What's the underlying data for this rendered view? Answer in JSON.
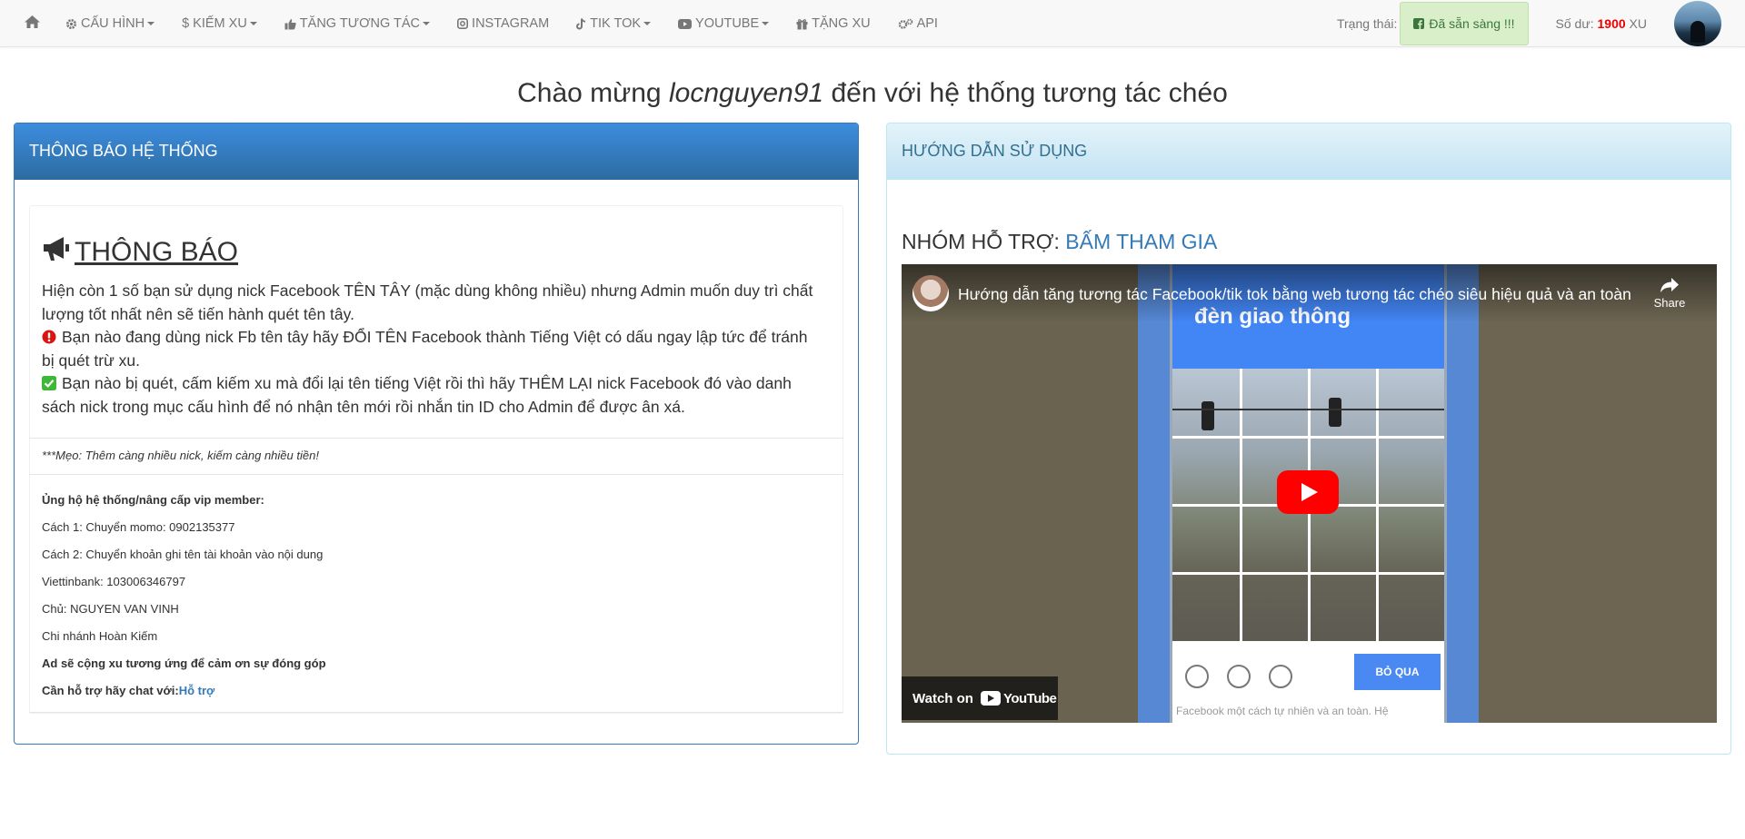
{
  "nav": {
    "items": [
      {
        "label": "CẤU HÌNH",
        "icon": "cog-icon"
      },
      {
        "label": "KIẾM XU",
        "icon": "dollar-icon"
      },
      {
        "label": "TĂNG TƯƠNG TÁC",
        "icon": "thumbs-up-icon"
      },
      {
        "label": "INSTAGRAM",
        "icon": "instagram-icon"
      },
      {
        "label": "TIK TOK",
        "icon": "tiktok-icon"
      },
      {
        "label": "YOUTUBE",
        "icon": "youtube-icon"
      },
      {
        "label": "TẶNG XU",
        "icon": "gift-icon"
      },
      {
        "label": "API",
        "icon": "cogs-icon"
      }
    ],
    "status_label": "Trạng thái:",
    "status_badge": "Đã sẵn sàng !!!",
    "balance_label": "Số dư:",
    "balance_amount": "1900",
    "balance_unit": "XU"
  },
  "welcome": {
    "before": "Chào mừng",
    "username": "locnguyen91",
    "after": "đến với hệ thống tương tác chéo"
  },
  "left_panel": {
    "heading": "THÔNG BÁO HỆ THỐNG",
    "notice_title": "THÔNG BÁO",
    "paragraphs": [
      "Hiện còn 1 số bạn sử dụng nick Facebook TÊN TÂY (mặc dùng không nhiều) nhưng Admin muốn duy trì chất lượng tốt nhất nên sẽ tiến hành quét tên tây.",
      "Bạn nào đang dùng nick Fb tên tây hãy ĐỔI TÊN Facebook thành Tiếng Việt có dấu ngay lập tức để tránh bị quét trừ xu.",
      "Bạn nào bị quét, cấm kiếm xu mà đổi lại tên tiếng Việt rồi thì hãy THÊM LẠI nick Facebook đó vào danh sách nick trong mục cấu hình để nó nhận tên mới rồi nhắn tin ID cho Admin để được ân xá."
    ],
    "tip": "***Mẹo: Thêm càng nhiều nick, kiếm càng nhiều tiền!",
    "support": {
      "title": "Ủng hộ hệ thống/nâng cấp vip member:",
      "line1": "Cách 1: Chuyển momo: 0902135377",
      "line2": "Cách 2: Chuyển khoản ghi tên tài khoản vào nội dung",
      "line3": "Viettinbank: 103006346797",
      "line4": "Chủ: NGUYEN VAN VINH",
      "line5": "Chi nhánh Hoàn Kiếm",
      "thanks": "Ad sẽ cộng xu tương ứng để cảm ơn sự đóng góp",
      "help_label": "Cần hỗ trợ hãy chat với:",
      "help_link": "Hỗ trợ"
    }
  },
  "right_panel": {
    "heading": "HƯỚNG DẪN SỬ DỤNG",
    "group_label": "NHÓM HỖ TRỢ:",
    "group_link": "BẤM THAM GIA",
    "video": {
      "title": "Hướng dẫn tăng tương tác Facebook/tik tok bằng web tương tác chéo siêu hiệu quả và an toàn",
      "share": "Share",
      "watch_on": "Watch on",
      "youtube": "YouTube",
      "captcha_title": "đèn giao thông",
      "skip": "BỎ QUA",
      "faint_text": "Facebook một cách tự nhiên và an toàn. Hệ"
    }
  }
}
